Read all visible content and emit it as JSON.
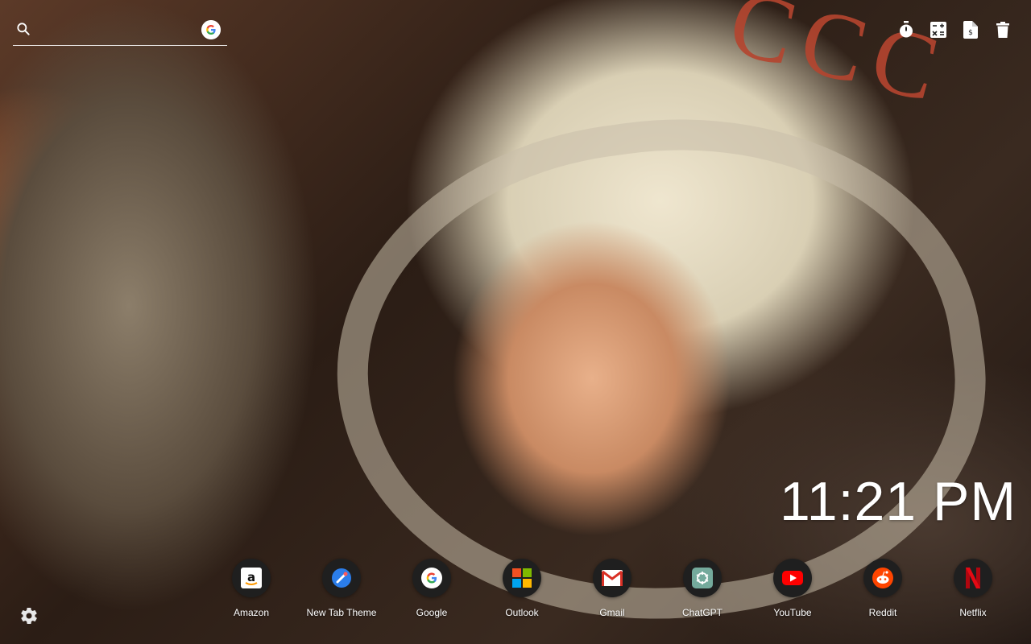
{
  "background": {
    "description_colors": {
      "sepia": "#d9cfb4",
      "red": "#b5452f"
    },
    "helmet_text": "CCC"
  },
  "search": {
    "placeholder": "",
    "value": "",
    "icon": "search-icon",
    "engine_icon": "google-icon"
  },
  "toolbar": {
    "items": [
      {
        "icon": "stopwatch-icon"
      },
      {
        "icon": "calculator-icon"
      },
      {
        "icon": "document-icon"
      },
      {
        "icon": "trash-icon"
      }
    ]
  },
  "clock": {
    "time": "11:21 PM"
  },
  "shortcuts": [
    {
      "label": "Amazon",
      "icon": "amazon-icon"
    },
    {
      "label": "New Tab Theme",
      "icon": "new-tab-theme-icon"
    },
    {
      "label": "Google",
      "icon": "google-icon"
    },
    {
      "label": "Outlook",
      "icon": "microsoft-icon"
    },
    {
      "label": "Gmail",
      "icon": "gmail-icon"
    },
    {
      "label": "ChatGPT",
      "icon": "chatgpt-icon"
    },
    {
      "label": "YouTube",
      "icon": "youtube-icon"
    },
    {
      "label": "Reddit",
      "icon": "reddit-icon"
    },
    {
      "label": "Netflix",
      "icon": "netflix-icon"
    }
  ],
  "settings": {
    "icon": "gear-icon"
  },
  "colors": {
    "text": "#ffffff",
    "dock_circle": "#1f1f1f"
  }
}
